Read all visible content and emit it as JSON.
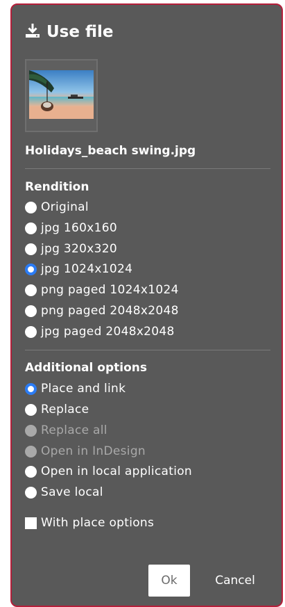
{
  "dialog": {
    "title": "Use file",
    "title_icon": "download-icon",
    "filename": "Holidays_beach swing.jpg"
  },
  "rendition": {
    "heading": "Rendition",
    "selected": "jpg 1024x1024",
    "options": [
      {
        "label": "Original"
      },
      {
        "label": "jpg 160x160"
      },
      {
        "label": "jpg 320x320"
      },
      {
        "label": "jpg 1024x1024"
      },
      {
        "label": "png paged 1024x1024"
      },
      {
        "label": "png paged 2048x2048"
      },
      {
        "label": "jpg paged 2048x2048"
      }
    ]
  },
  "additional": {
    "heading": "Additional options",
    "selected": "Place and link",
    "options": [
      {
        "label": "Place and link",
        "enabled": true
      },
      {
        "label": "Replace",
        "enabled": true
      },
      {
        "label": "Replace all",
        "enabled": false
      },
      {
        "label": "Open in InDesign",
        "enabled": false
      },
      {
        "label": "Open in local application",
        "enabled": true
      },
      {
        "label": "Save local",
        "enabled": true
      }
    ],
    "with_place_options": {
      "label": "With place options",
      "checked": false
    }
  },
  "buttons": {
    "ok_label": "Ok",
    "cancel_label": "Cancel"
  },
  "colors": {
    "panel_bg": "#595959",
    "border": "#b51e3a",
    "selected_radio": "#2b7cf5",
    "disabled_text": "#a9a9a9"
  }
}
